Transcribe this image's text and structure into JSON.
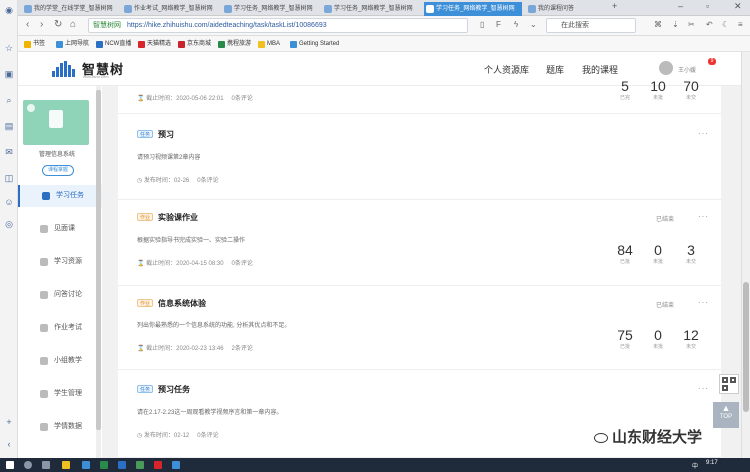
{
  "tabs": [
    {
      "label": "我的学堂_在线学堂_智慧树网",
      "active": false
    },
    {
      "label": "作业考试_网络教学_智慧树网",
      "active": false
    },
    {
      "label": "学习任务_网络教学_智慧树网",
      "active": false
    },
    {
      "label": "学习任务_网络教学_智慧树网",
      "active": false
    },
    {
      "label": "学习任务_网络教学_智慧树网",
      "active": true
    },
    {
      "label": "我的课程问答",
      "active": false
    }
  ],
  "address": {
    "secure_label": "智慧树网",
    "url": "https://hike.zhihuishu.com/aidedteaching/task/taskList/10086693",
    "search_placeholder": "在此搜索"
  },
  "bookmarks": [
    "书签",
    "上网导航",
    "NCW直播",
    "天猫精选",
    "京东商城",
    "携程旅游",
    "MBA",
    "Getting Started"
  ],
  "header": {
    "logo_text": "智慧树",
    "logo_sub": "zhihuishu.com",
    "nav": [
      "个人资源库",
      "题库",
      "我的课程"
    ],
    "user_name": "王小媛",
    "badge": "9"
  },
  "course": {
    "name": "管理信息系统",
    "detail_button": "课程掌握",
    "menu": [
      {
        "label": "学习任务",
        "active": true
      },
      {
        "label": "见面课",
        "active": false
      },
      {
        "label": "学习资源",
        "active": false
      },
      {
        "label": "问答讨论",
        "active": false
      },
      {
        "label": "作业考试",
        "active": false
      },
      {
        "label": "小组教学",
        "active": false
      },
      {
        "label": "学生管理",
        "active": false
      },
      {
        "label": "学情数据",
        "active": false
      }
    ]
  },
  "tasks": [
    {
      "tag": "",
      "title": "",
      "desc": "",
      "meta_label": "截止时间：",
      "meta_time": "2020-05-06 22:01",
      "comments": "0条评论",
      "status": "",
      "stats": [
        {
          "n": "5",
          "l": "已完"
        },
        {
          "n": "10",
          "l": "未批"
        },
        {
          "n": "70",
          "l": "未交"
        }
      ]
    },
    {
      "tag": "任务",
      "title": "预习",
      "desc": "请预习视频课第2章内容",
      "meta_label": "发布时间：",
      "meta_time": "02-26",
      "comments": "0条评论",
      "status": "",
      "stats": []
    },
    {
      "tag": "作业",
      "title": "实验课作业",
      "desc": "根据实验指导书完成实验一、实验二操作",
      "meta_label": "截止时间：",
      "meta_time": "2020-04-15 08:30",
      "comments": "0条评论",
      "status": "已结束",
      "stats": [
        {
          "n": "84",
          "l": "已批"
        },
        {
          "n": "0",
          "l": "未批"
        },
        {
          "n": "3",
          "l": "未交"
        }
      ]
    },
    {
      "tag": "作业",
      "title": "信息系统体验",
      "desc": "列出你最熟悉的一个信息系统的功能, 分析其优点和不足。",
      "meta_label": "截止时间：",
      "meta_time": "2020-02-23 13:46",
      "comments": "2条评论",
      "status": "已结束",
      "stats": [
        {
          "n": "75",
          "l": "已批"
        },
        {
          "n": "0",
          "l": "未批"
        },
        {
          "n": "12",
          "l": "未交"
        }
      ]
    },
    {
      "tag": "任务",
      "title": "预习任务",
      "desc": "请在2.17-2.23这一周观看教学视频序言和第一章内容。",
      "meta_label": "发布时间：",
      "meta_time": "02-12",
      "comments": "0条评论",
      "status": "",
      "stats": []
    }
  ],
  "float": {
    "top_label": "TOP"
  },
  "watermark": "山东财经大学",
  "taskbar": {
    "ime": "中",
    "clock": "9:17"
  }
}
